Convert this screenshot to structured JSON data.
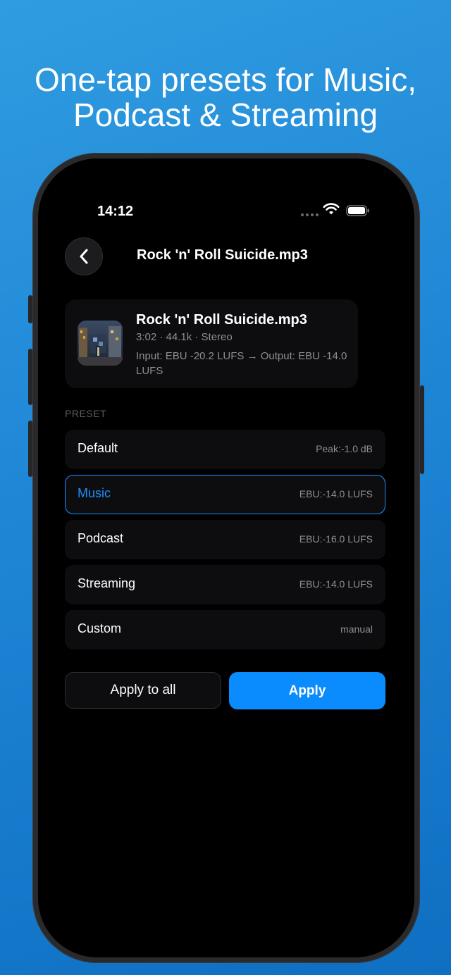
{
  "headline": {
    "line1": "One-tap presets for Music,",
    "line2": "Podcast & Streaming"
  },
  "status_bar": {
    "time": "14:12",
    "icons": [
      "signal-dots-icon",
      "wifi-icon",
      "battery-icon"
    ]
  },
  "nav": {
    "back_icon": "chevron-left-icon",
    "title": "Rock 'n' Roll Suicide.mp3"
  },
  "file": {
    "title": "Rock 'n' Roll Suicide.mp3",
    "meta": "3:02 · 44.1k · Stereo",
    "loudness": "Input: EBU -20.2 LUFS → Output: EBU -14.0 LUFS"
  },
  "presets": {
    "section_label": "PRESET",
    "items": [
      {
        "name": "Default",
        "value": "Peak:-1.0 dB"
      },
      {
        "name": "Music",
        "value": "EBU:-14.0 LUFS",
        "selected": true
      },
      {
        "name": "Podcast",
        "value": "EBU:-16.0 LUFS"
      },
      {
        "name": "Streaming",
        "value": "EBU:-14.0 LUFS"
      },
      {
        "name": "Custom",
        "value": "manual"
      }
    ]
  },
  "actions": {
    "apply_all_label": "Apply to all",
    "apply_label": "Apply"
  },
  "colors": {
    "accent": "#0a8cff",
    "background_gradient_start": "#2f9ce0",
    "background_gradient_end": "#0f6fc2",
    "screen": "#000000",
    "card": "#0d0d0f"
  }
}
